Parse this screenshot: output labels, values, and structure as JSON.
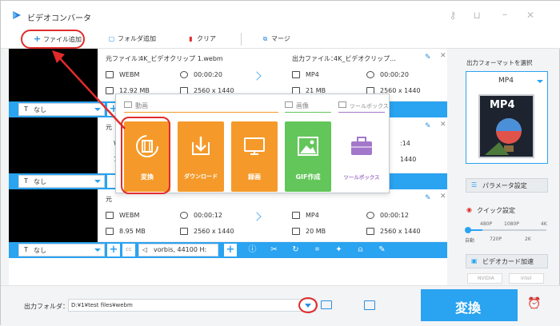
{
  "app": {
    "title": "ビデオコンバータ"
  },
  "toolbar": {
    "add_file": "ファイル追加",
    "add_folder": "フォルダ追加",
    "clear": "クリア",
    "merge": "マージ"
  },
  "files": [
    {
      "src_label": "元ファイル：",
      "src_name": "4K_ビデオクリップ 1.webm",
      "out_label": "出力ファイル：",
      "out_name": "4K_ビデオクリップ...",
      "src_format": "WEBM",
      "src_duration": "00:00:20",
      "src_size": "12.92 MB",
      "src_res": "2560 x 1440",
      "out_format": "MP4",
      "out_duration": "00:00:20",
      "out_size": "21 MB",
      "out_res": "2560 x 1440",
      "subtitle": "なし"
    },
    {
      "src_label": "元",
      "src_format": "WE",
      "src_size": "19",
      "out_duration": ":14",
      "out_res": "1440",
      "subtitle": "なし"
    },
    {
      "src_label": "元",
      "src_format": "WEBM",
      "src_duration": "00:00:12",
      "src_size": "8.95 MB",
      "src_res": "2560 x 1440",
      "out_format": "MP4",
      "out_duration": "00:00:12",
      "out_size": "20 MB",
      "out_res": "2560 x 1440",
      "subtitle": "なし",
      "audio": "vorbis, 44100 H:"
    }
  ],
  "popup": {
    "section_video": "動画",
    "section_image": "画像",
    "section_toolbox": "ツールボックス",
    "cards": [
      {
        "label": "変換",
        "color": "#f59a2a",
        "icon": "film-icon"
      },
      {
        "label": "ダウンロード",
        "color": "#f59a2a",
        "icon": "download-icon"
      },
      {
        "label": "録画",
        "color": "#f59a2a",
        "icon": "screen-record-icon"
      },
      {
        "label": "GIF作成",
        "color": "#63c65a",
        "icon": "gif-image-icon"
      },
      {
        "label": "ツールボックス",
        "color": "#a377c9",
        "icon": "toolbox-icon"
      }
    ]
  },
  "right": {
    "format_select_label": "出力フォーマットを選択",
    "format_name": "MP4",
    "format_badge": "MP4",
    "param_settings": "パラメータ設定",
    "quick_settings": "クイック設定",
    "quality_top": [
      "480P",
      "1080P",
      "4K"
    ],
    "quality_bottom": [
      "自動",
      "720P",
      "2K"
    ],
    "gpu_accel": "ビデオカード加速",
    "gpu_nvidia": "NVIDIA",
    "gpu_intel": "Intel"
  },
  "bottom": {
    "output_folder_label": "出力フォルダ：",
    "output_path": "D:¥1¥test files¥webm",
    "convert": "変換"
  },
  "colors": {
    "accent": "#2aa3f1",
    "highlight_red": "#e12b2b",
    "orange": "#f59a2a",
    "green": "#63c65a",
    "purple": "#a377c9"
  }
}
